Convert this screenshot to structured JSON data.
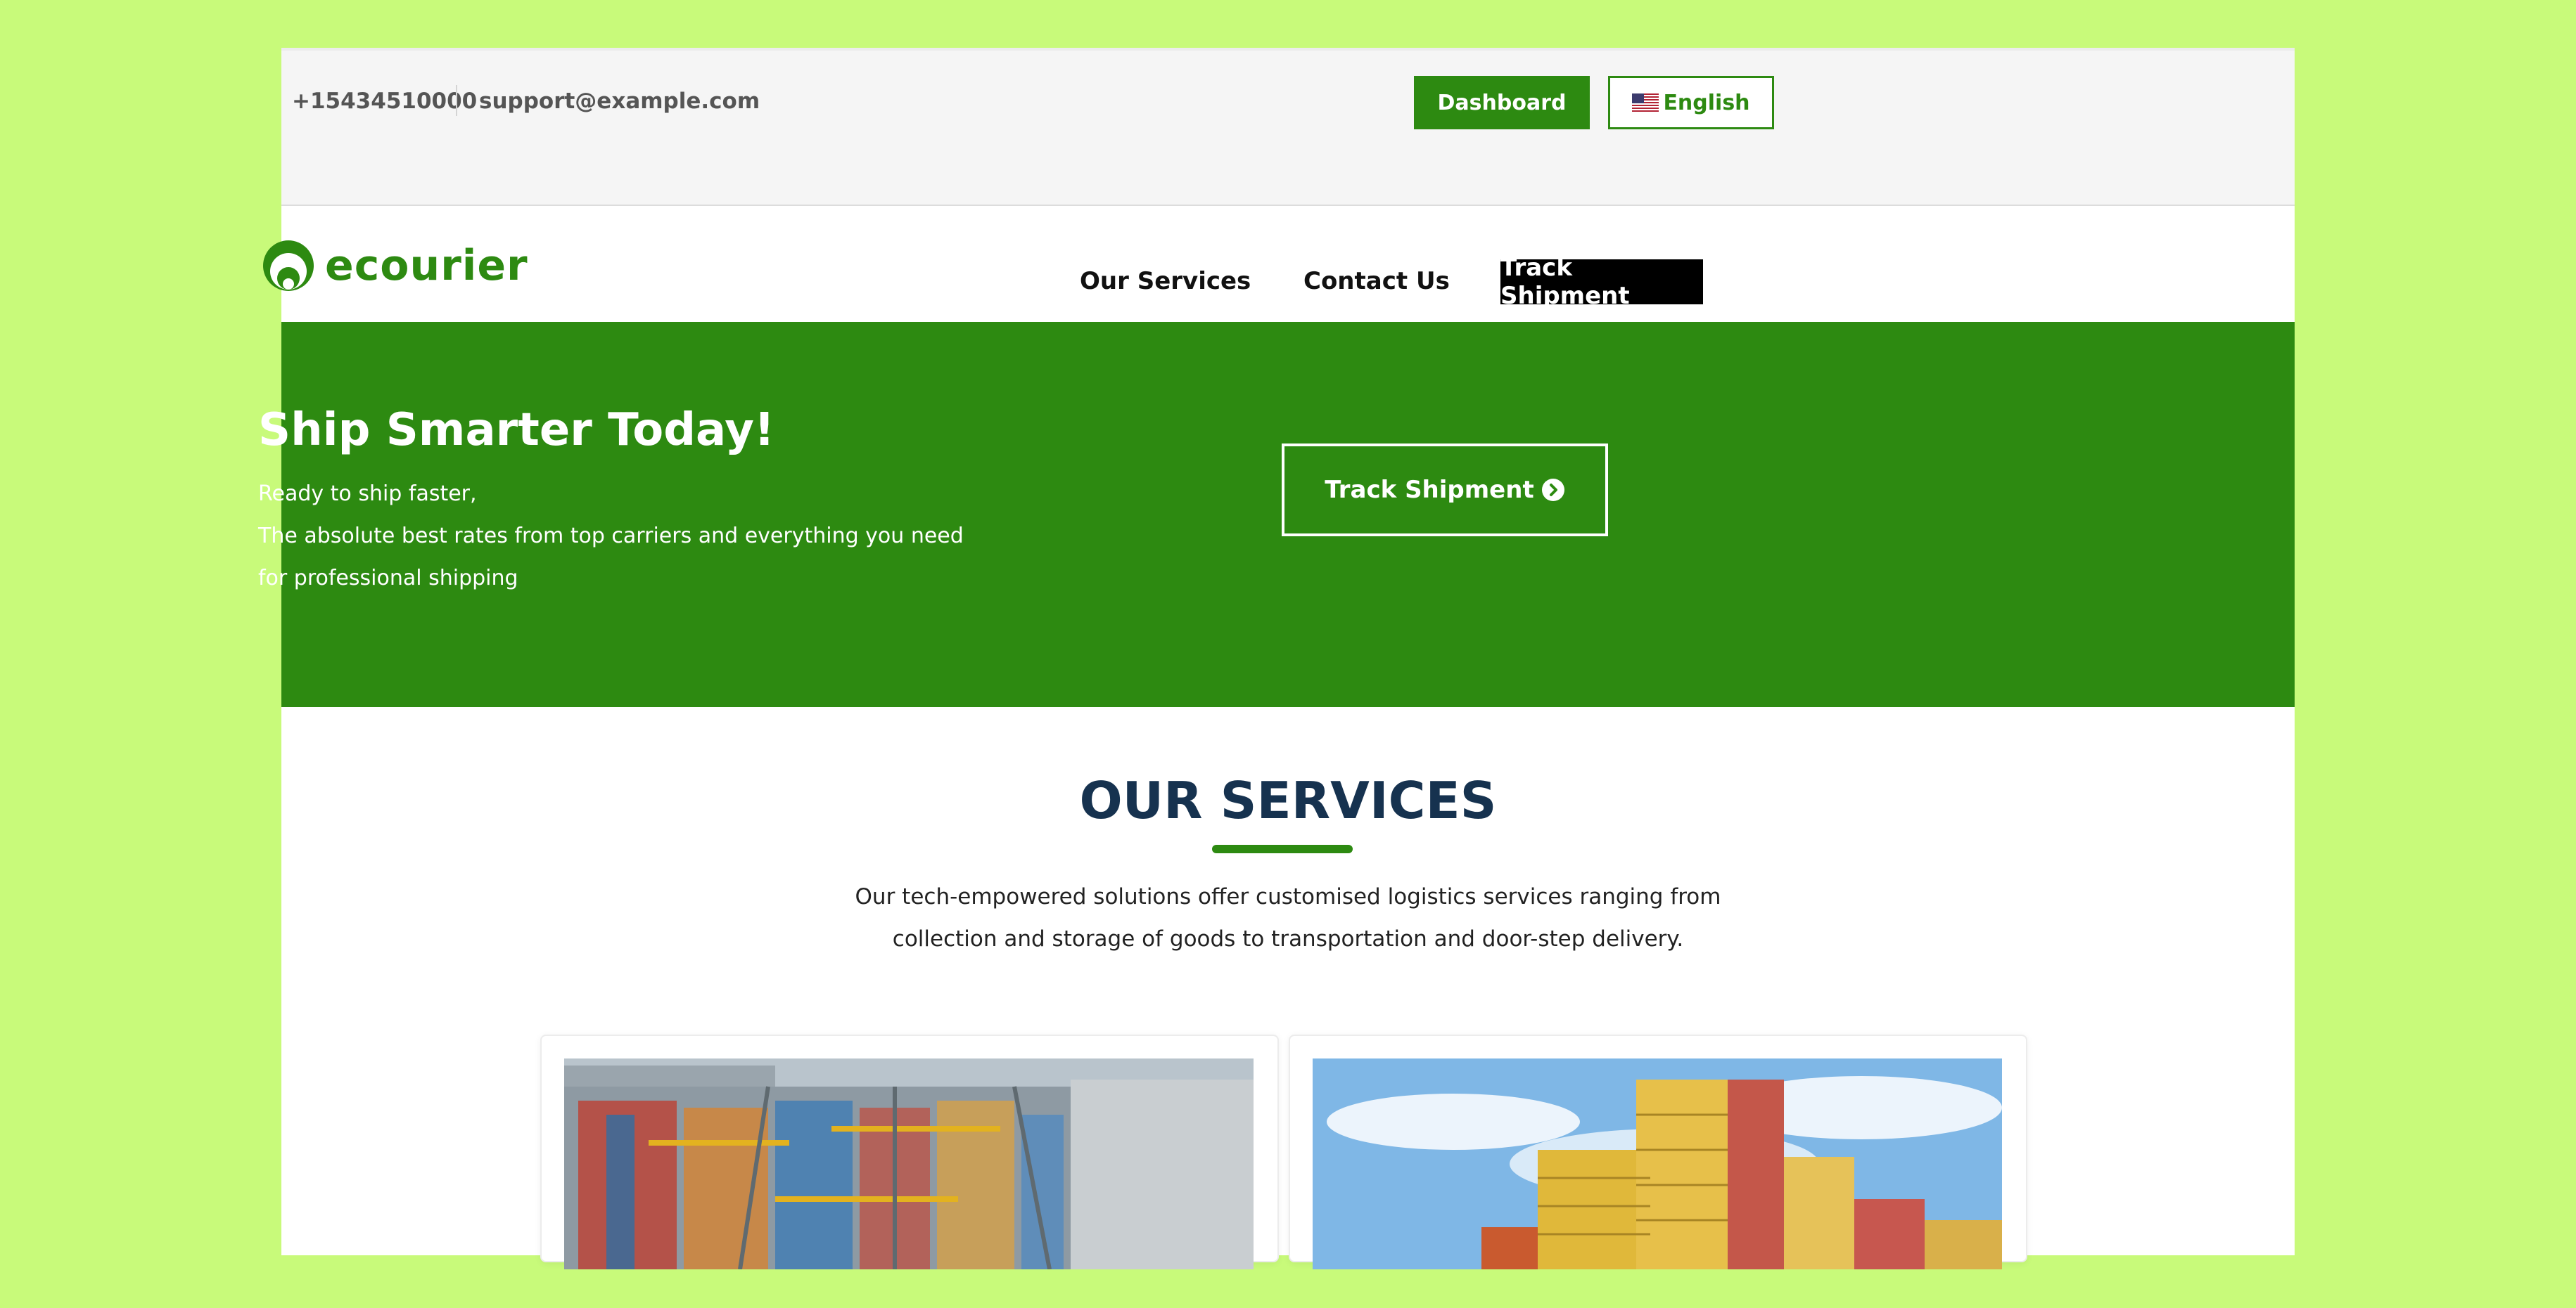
{
  "topbar": {
    "phone": "+15434510000",
    "email": "support@example.com",
    "dashboard_label": "Dashboard",
    "language_label": "English",
    "language_flag": "us-flag-icon"
  },
  "header": {
    "logo_text": "ecourier",
    "nav": {
      "services": "Our Services",
      "contact": "Contact Us",
      "track": "Track Shipment"
    }
  },
  "hero": {
    "title": "Ship Smarter Today!",
    "line1": "Ready to ship faster,",
    "line2": "The absolute best rates from top carriers and everything you need",
    "line3": "for professional shipping",
    "cta_label": "Track Shipment",
    "cta_icon": "chevron-circle-right-icon"
  },
  "services": {
    "title": "OUR SERVICES",
    "line1": "Our tech-empowered solutions offer customised logistics services ranging from",
    "line2": "collection and storage of goods to transportation and door-step delivery."
  },
  "colors": {
    "brand_green": "#2d8a11",
    "heading_navy": "#16324f",
    "page_bg": "#c8fa7a"
  }
}
